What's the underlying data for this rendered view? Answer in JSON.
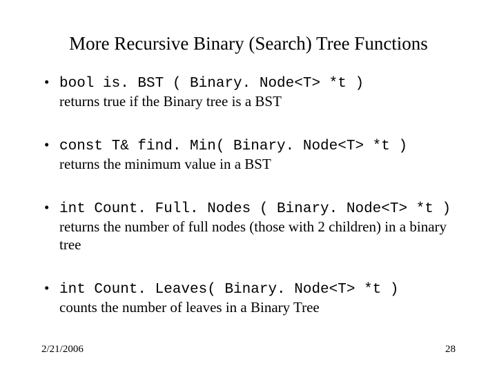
{
  "title": "More Recursive Binary (Search) Tree Functions",
  "items": [
    {
      "code": "bool is. BST ( Binary. Node<T> *t )",
      "desc": "returns true if the Binary tree is a BST"
    },
    {
      "code": "const T& find. Min( Binary. Node<T> *t )",
      "desc": "returns the minimum value in a BST"
    },
    {
      "code": "int Count. Full. Nodes ( Binary. Node<T> *t )",
      "desc": "returns the number of full nodes (those with 2 children) in a binary tree"
    },
    {
      "code": "int Count. Leaves( Binary. Node<T> *t )",
      "desc": "counts the number of leaves in a Binary Tree"
    }
  ],
  "footer": {
    "date": "2/21/2006",
    "page": "28"
  }
}
